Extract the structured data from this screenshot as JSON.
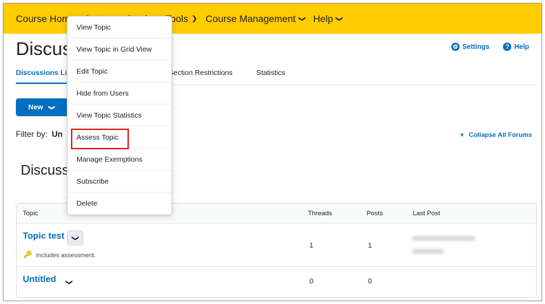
{
  "nav": {
    "items": [
      {
        "label": "Course Home",
        "chevron": false
      },
      {
        "label": "Content",
        "chevron": false
      },
      {
        "label": "Grades",
        "chevron": false
      },
      {
        "label": "Tools",
        "chevron": true
      },
      {
        "label": "Course Management",
        "chevron": true
      },
      {
        "label": "Help",
        "chevron": true
      }
    ],
    "bar_color": "#ffcc00"
  },
  "page": {
    "title": "Discussions",
    "settings_label": "Settings",
    "help_label": "Help",
    "accent_color": "#006fbf"
  },
  "tabs": [
    {
      "label": "Discussions List",
      "active": true
    },
    {
      "label": "d Section Restrictions",
      "active": false
    },
    {
      "label": "Statistics",
      "active": false
    }
  ],
  "toolbar": {
    "new_label": "New"
  },
  "filter": {
    "label": "Filter by:",
    "value": "Un"
  },
  "collapse_label": "Collapse All Forums",
  "section_heading": "Discussi",
  "table": {
    "headers": {
      "topic": "Topic",
      "threads": "Threads",
      "posts": "Posts",
      "last_post": "Last Post"
    },
    "rows": [
      {
        "topic": "Topic test",
        "note": "Includes assessment.",
        "threads": "1",
        "posts": "1"
      },
      {
        "topic": "Untitled",
        "threads": "0",
        "posts": "0"
      }
    ]
  },
  "menu": {
    "items": [
      "View Topic",
      "View Topic in Grid View",
      "Edit Topic",
      "Hide from Users",
      "View Topic Statistics",
      "Assess Topic",
      "Manage Exemptions",
      "Subscribe",
      "Delete"
    ],
    "highlighted_item": "Assess Topic",
    "highlight_color": "#e11c1c"
  }
}
